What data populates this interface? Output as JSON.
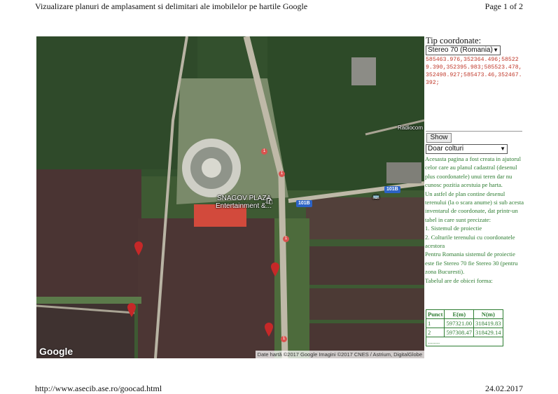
{
  "header": {
    "title": "Vizualizare planuri de amplasament si delimitari ale imobilelor pe hartile Google",
    "page": "Page 1 of 2"
  },
  "footer": {
    "url": "http://www.asecib.ase.ro/goocad.html",
    "date": "24.02.2017"
  },
  "map": {
    "place_label_1": "SNAGOV PLAZA",
    "place_label_2": "Entertainment &...",
    "road_101B_a": "101B",
    "road_101B_b": "101B",
    "road_1": "1",
    "place_radio": "Radiocom",
    "google_logo": "Google",
    "attribution": "Date hartă ©2017 Google  Imagini ©2017 CNES / Astrium, DigitalGlobe",
    "colors": {
      "marker": "#c62828",
      "fields": "#4a3433",
      "forest": "#2f4a2a"
    },
    "icons": [
      "map-marker-icon",
      "shopping-bag-icon",
      "bus-icon"
    ]
  },
  "panel": {
    "tip_label": "Tip coordonate:",
    "projection_selected": "Stereo 70 (Romania)",
    "coordinates_text": "585463.976,352364.496;585229.390,352395.983;585523.478,352498.927;585473.46,352467.392;",
    "show_button": "Show",
    "mode_selected": "Doar colturi",
    "description": [
      "Acesasta pagina a fost creata in ajutorul celor care au planul cadastral (desenul plus coordonatele) unui teren dar nu cunosc pozitia acestuia pe harta.",
      "Un astfel de plan contine desenul terenului (la o scara anume) si sub acesta inventarul de coordonate, dat printr-un tabel in care sunt precizate:",
      "1. Sistemul de proiectie",
      "2. Colturile terenului cu coordonatele acestora",
      "Pentru Romania sistemul de proiectie este fie Stereo 70 fie Stereo 30 (pentru zona Bucuresti).",
      "Tabelul are de obicei forma:"
    ],
    "table": {
      "headers": [
        "Punct",
        "E(m)",
        "N(m)"
      ],
      "rows": [
        [
          "1",
          "597321.00",
          "318419.83"
        ],
        [
          "2",
          "597308.47",
          "318429.14"
        ],
        [
          "........",
          "",
          ""
        ]
      ]
    }
  }
}
